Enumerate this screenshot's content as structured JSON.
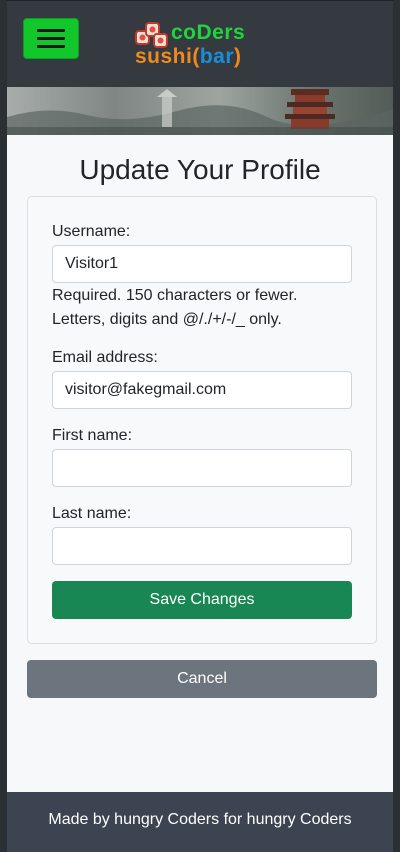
{
  "header": {
    "logo_line1": "coDers",
    "logo_line2_a": "sushi",
    "logo_paren_open": "(",
    "logo_line2_b": "bar",
    "logo_paren_close": ")"
  },
  "page": {
    "title": "Update Your Profile"
  },
  "form": {
    "username_label": "Username:",
    "username_value": "Visitor1",
    "username_help_1": "Required. 150 characters or fewer.",
    "username_help_2": "Letters, digits and @/./+/-/_ only.",
    "email_label": "Email address:",
    "email_value": "visitor@fakegmail.com",
    "first_name_label": "First name:",
    "first_name_value": "",
    "last_name_label": "Last name:",
    "last_name_value": "",
    "save_label": "Save Changes"
  },
  "actions": {
    "cancel_label": "Cancel"
  },
  "footer": {
    "text": "Made by hungry Coders for hungry Coders"
  },
  "colors": {
    "navbar": "#343a40",
    "menu_button": "#12c72b",
    "save_button": "#198754",
    "cancel_button": "#6c757d",
    "footer": "#3b4450"
  }
}
